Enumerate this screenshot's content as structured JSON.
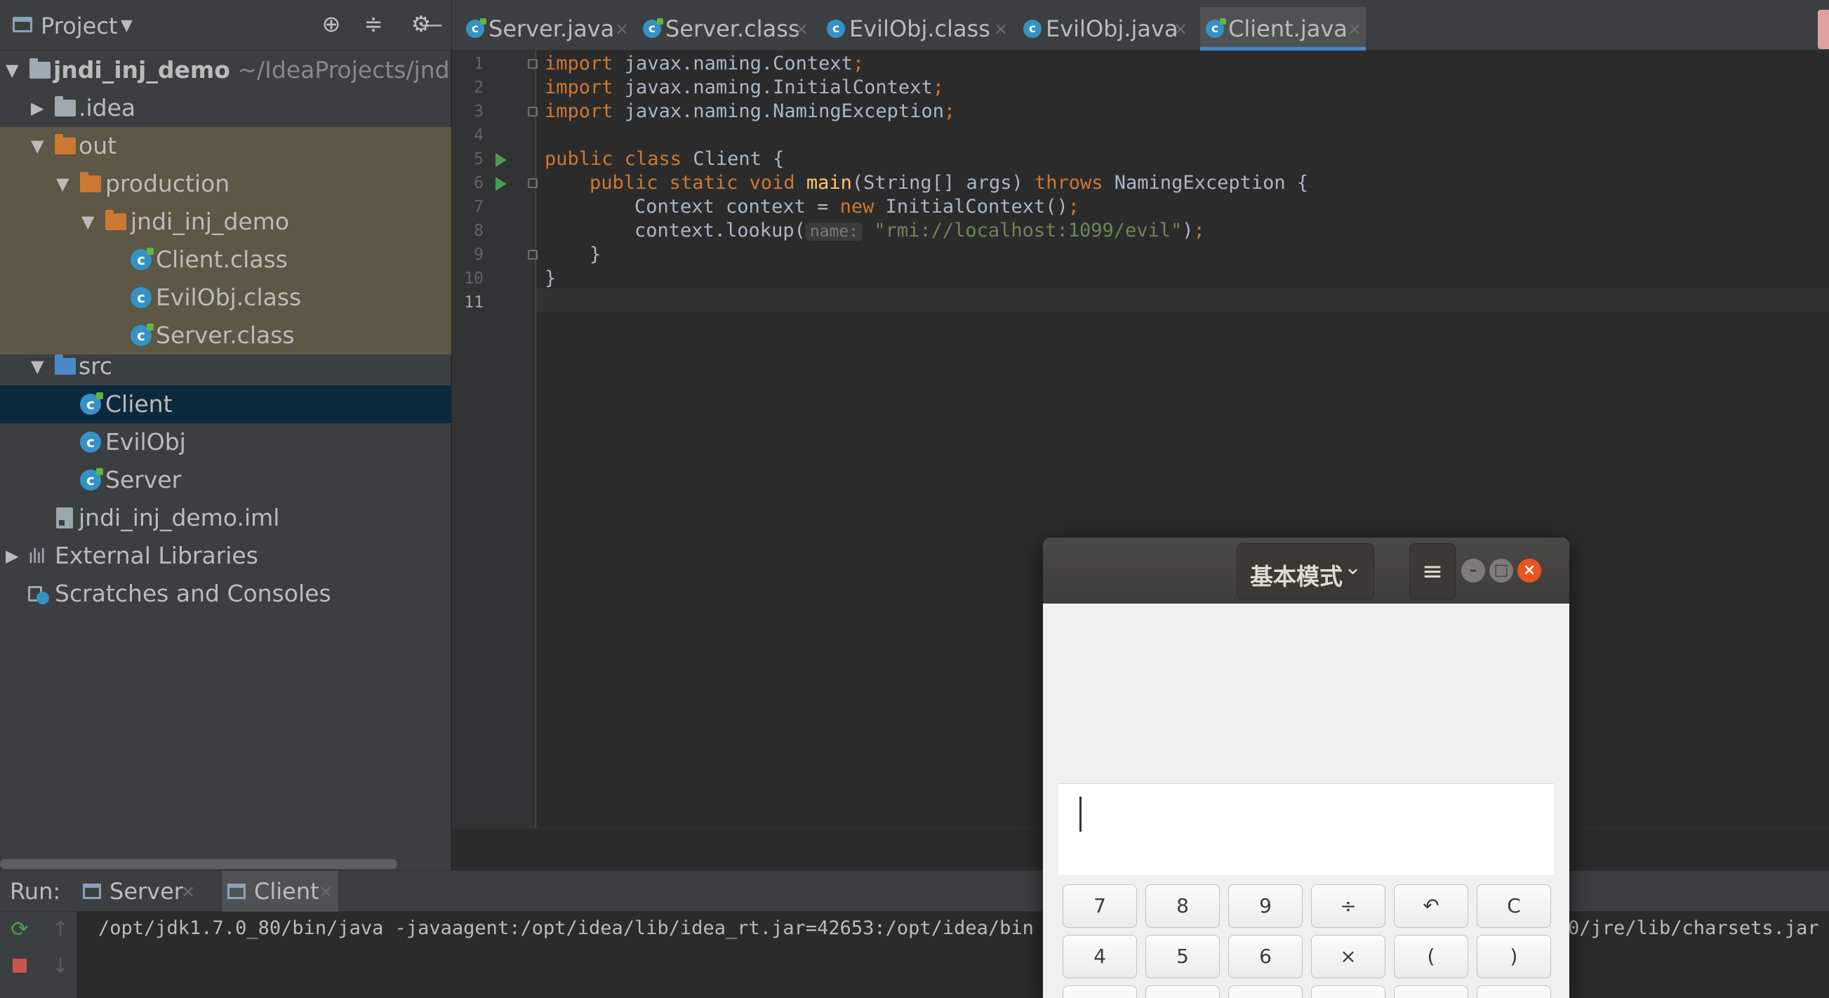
{
  "project": {
    "title": "Project",
    "tree": [
      {
        "label": "jndi_inj_demo",
        "path": " ~/IdeaProjects/jndi_inj_"
      },
      {
        "label": ".idea"
      },
      {
        "label": "out"
      },
      {
        "label": "production"
      },
      {
        "label": "jndi_inj_demo"
      },
      {
        "label": "Client.class"
      },
      {
        "label": "EvilObj.class"
      },
      {
        "label": "Server.class"
      },
      {
        "label": "src"
      },
      {
        "label": "Client"
      },
      {
        "label": "EvilObj"
      },
      {
        "label": "Server"
      },
      {
        "label": "jndi_inj_demo.iml"
      },
      {
        "label": "External Libraries"
      },
      {
        "label": "Scratches and Consoles"
      }
    ]
  },
  "editor": {
    "tabs": [
      {
        "label": "Server.java"
      },
      {
        "label": "Server.class"
      },
      {
        "label": "EvilObj.class"
      },
      {
        "label": "EvilObj.java"
      },
      {
        "label": "Client.java"
      }
    ],
    "active_tab": "Client.java",
    "line_numbers": [
      "1",
      "2",
      "3",
      "4",
      "5",
      "6",
      "7",
      "8",
      "9",
      "10",
      "11"
    ],
    "code": {
      "l1": {
        "kw": "import",
        "rest": " javax.naming.Context",
        "semi": ";"
      },
      "l2": {
        "kw": "import",
        "rest": " javax.naming.InitialContext",
        "semi": ";"
      },
      "l3": {
        "kw": "import",
        "rest": " javax.naming.NamingException",
        "semi": ";"
      },
      "l5": {
        "kw": "public class",
        "rest": " Client {"
      },
      "l6": {
        "kw": "public static void ",
        "fn": "main",
        "args": "(String[] args) ",
        "kw2": "throws",
        "rest": " NamingException {"
      },
      "l7": {
        "pre": "Context context = ",
        "kw": "new",
        "rest": " InitialContext()",
        "semi": ";"
      },
      "l8": {
        "pre": "context.lookup(",
        "hint": "name:",
        "str": "\"rmi://localhost:1099/evil\"",
        "rest": ")",
        "semi": ";"
      },
      "l9": "}",
      "l10": "}"
    }
  },
  "run": {
    "label": "Run:",
    "tabs": [
      {
        "label": "Server"
      },
      {
        "label": "Client"
      }
    ],
    "console_left": "/opt/jdk1.7.0_80/bin/java -javaagent:/opt/idea/lib/idea_rt.jar=42653:/opt/idea/bin -",
    "console_right": "0/jre/lib/charsets.jar"
  },
  "calculator": {
    "mode_label": "基本模式",
    "menu_icon": "hamburger-menu-icon",
    "display_value": "",
    "keys_row1": [
      "7",
      "8",
      "9",
      "÷",
      "↶",
      "C"
    ],
    "keys_row2": [
      "4",
      "5",
      "6",
      "×",
      "(",
      ")"
    ]
  }
}
